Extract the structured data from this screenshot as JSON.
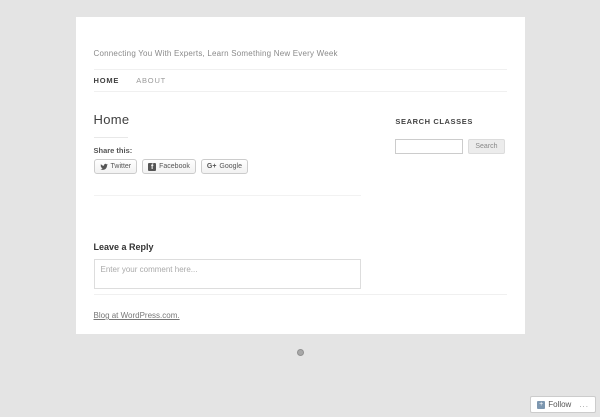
{
  "theme": {
    "page_bg": "#e4e4e4",
    "card_bg": "#ffffff",
    "divider": "#f0f0f0",
    "heading_text": "#404040",
    "muted_text": "#999999",
    "follow_icon_bg": "#7d97b0"
  },
  "header": {
    "tagline": "Connecting You With Experts, Learn Something New Every Week"
  },
  "nav": {
    "items": [
      {
        "label": "HOME"
      },
      {
        "label": "ABOUT"
      }
    ]
  },
  "main": {
    "title": "Home",
    "share": {
      "label": "Share this:",
      "buttons": [
        {
          "icon": "twitter-bird-icon",
          "label": "Twitter"
        },
        {
          "icon": "facebook-f-icon",
          "label": "Facebook",
          "glyph": "f"
        },
        {
          "icon": "google-plus-icon",
          "label": "Google",
          "glyph": "G+"
        }
      ]
    },
    "reply": {
      "title": "Leave a Reply",
      "placeholder": "Enter your comment here..."
    }
  },
  "sidebar": {
    "search_title": "SEARCH CLASSES",
    "search_value": "",
    "search_button_label": "Search"
  },
  "footer": {
    "credit_link": "Blog at WordPress.com."
  },
  "follow_bar": {
    "label": "Follow",
    "more_label": "..."
  }
}
